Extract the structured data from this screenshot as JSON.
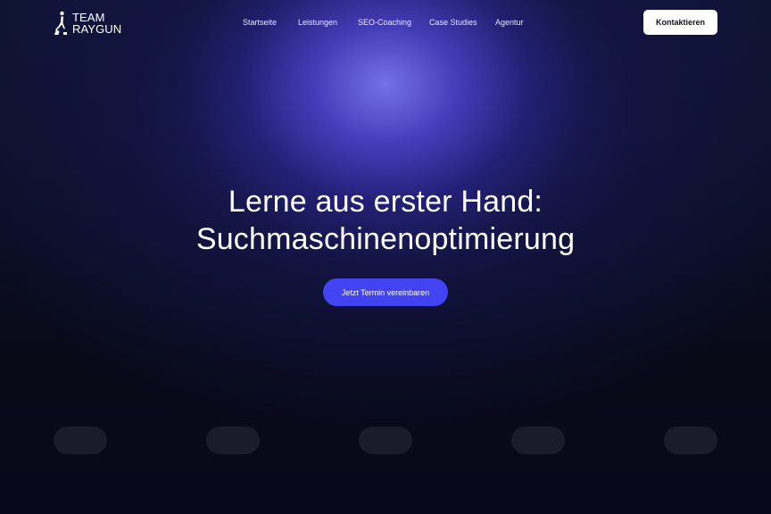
{
  "header": {
    "logo": {
      "line1": "TEAM",
      "line2": "RAYGUN",
      "icon": "raygun-figure-icon"
    },
    "nav": [
      {
        "label": "Startseite"
      },
      {
        "label": "Leistungen"
      },
      {
        "label": "SEO-Coaching"
      },
      {
        "label": "Case Studies"
      },
      {
        "label": "Agentur"
      }
    ],
    "contact_button": "Kontaktieren"
  },
  "hero": {
    "title_line1": "Lerne aus erster Hand:",
    "title_line2": "Suchmaschinenoptimierung",
    "cta_label": "Jetzt Termin vereinbaren"
  },
  "colors": {
    "cta": "#4244f2",
    "contact_button": "#ffffff",
    "background": "#07091a",
    "glow": "#6a68e6",
    "placeholder": "#1a1c2b"
  }
}
